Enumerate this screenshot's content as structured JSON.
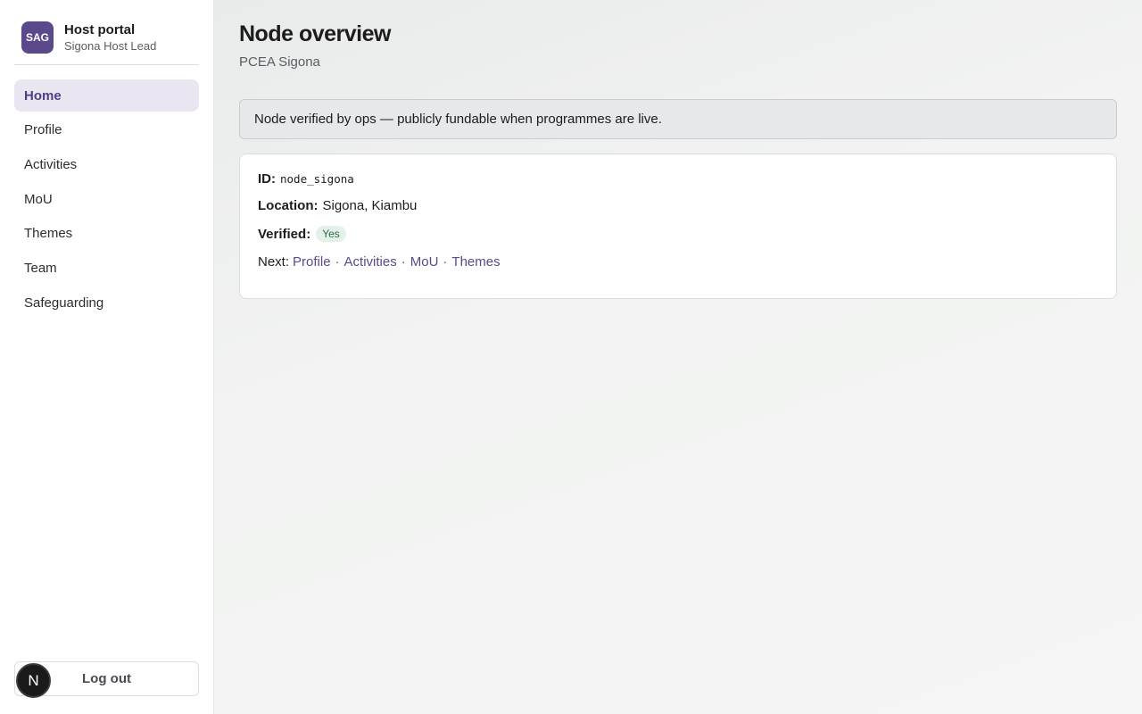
{
  "sidebar": {
    "logo_text": "SAG",
    "title": "Host portal",
    "subtitle": "Sigona Host Lead",
    "items": [
      {
        "label": "Home",
        "active": true
      },
      {
        "label": "Profile"
      },
      {
        "label": "Activities"
      },
      {
        "label": "MoU"
      },
      {
        "label": "Themes"
      },
      {
        "label": "Team"
      },
      {
        "label": "Safeguarding"
      }
    ],
    "logout_label": "Log out",
    "avatar_letter": "N"
  },
  "main": {
    "title": "Node overview",
    "subtitle": "PCEA Sigona",
    "banner": "Node verified by ops — publicly fundable when programmes are live.",
    "details": {
      "id_label": "ID:",
      "id_value": "node_sigona",
      "location_label": "Location:",
      "location_value": "Sigona, Kiambu",
      "verified_label": "Verified:",
      "verified_value": "Yes",
      "next_label": "Next:",
      "next_links": [
        "Profile",
        "Activities",
        "MoU",
        "Themes"
      ],
      "separator": "·"
    }
  },
  "colors": {
    "accent": "#5b4a8b",
    "active_nav_bg": "#e9e6f1",
    "badge_bg": "#e3f1e8",
    "badge_text": "#2f6b43"
  }
}
